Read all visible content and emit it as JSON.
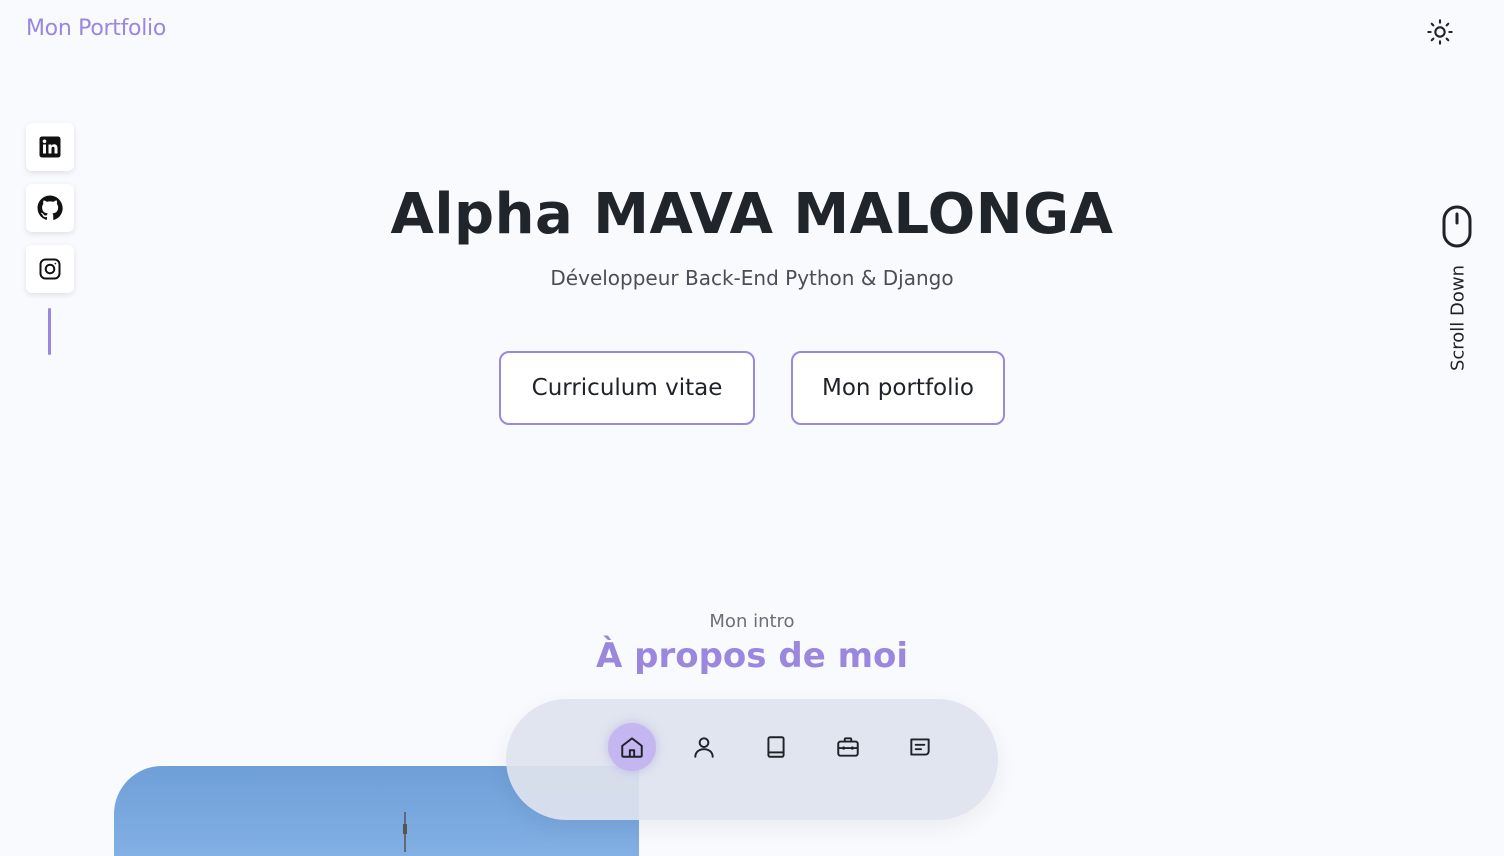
{
  "header": {
    "brand": "Mon Portfolio",
    "theme_toggle_icon": "sun-icon"
  },
  "social": [
    {
      "icon": "linkedin-icon",
      "label": "LinkedIn"
    },
    {
      "icon": "github-icon",
      "label": "GitHub"
    },
    {
      "icon": "instagram-icon",
      "label": "Instagram"
    }
  ],
  "hero": {
    "name": "Alpha MAVA MALONGA",
    "subtitle": "Développeur Back-End Python & Django",
    "buttons": [
      {
        "label": "Curriculum vitae"
      },
      {
        "label": "Mon portfolio"
      }
    ]
  },
  "scroll": {
    "label": "Scroll Down",
    "icon": "mouse-icon"
  },
  "about": {
    "subtitle": "Mon intro",
    "title": "À propos de moi"
  },
  "dock": {
    "items": [
      {
        "icon": "home-icon",
        "active": true
      },
      {
        "icon": "user-icon",
        "active": false
      },
      {
        "icon": "book-icon",
        "active": false
      },
      {
        "icon": "briefcase-icon",
        "active": false
      },
      {
        "icon": "message-icon",
        "active": false
      }
    ]
  },
  "colors": {
    "accent": "#9b87dd",
    "background": "#f9fafe",
    "text": "#1f2329"
  }
}
